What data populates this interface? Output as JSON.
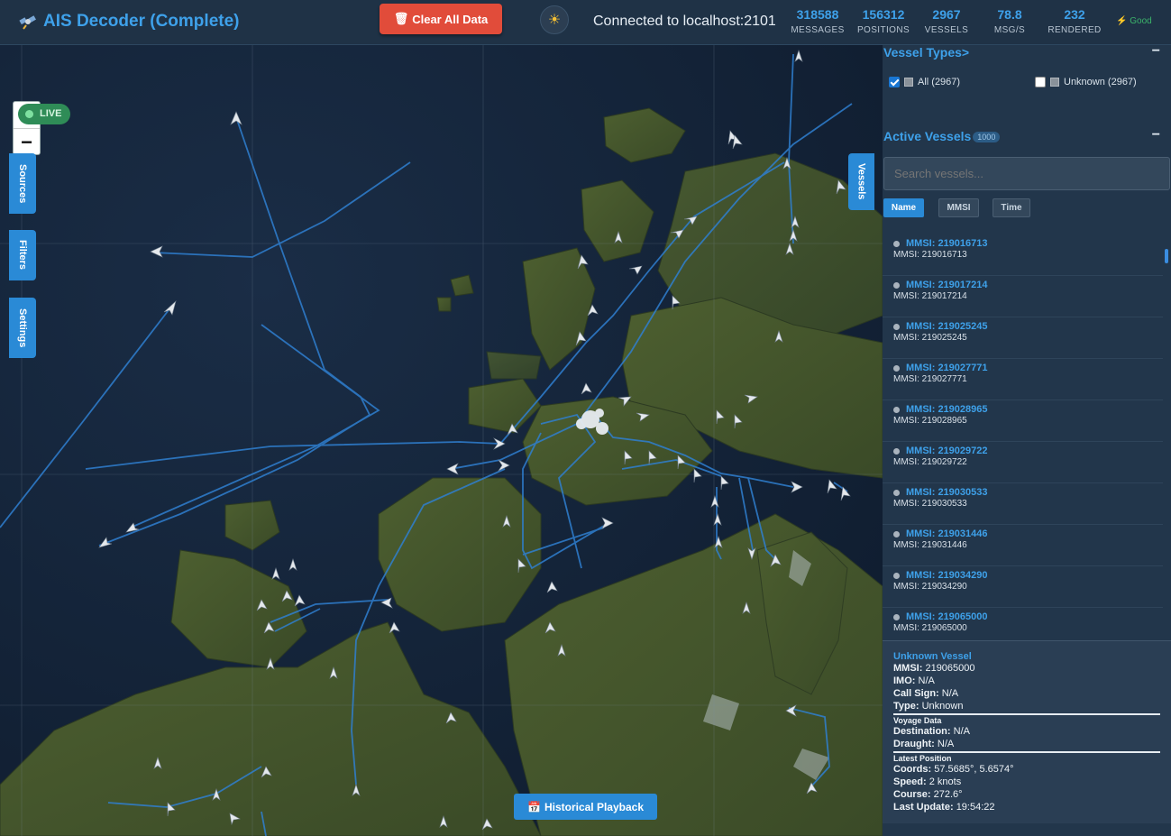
{
  "header": {
    "title": "AIS Decoder (Complete)",
    "clear_label": "Clear All Data",
    "theme_icon": "sun-icon",
    "connection": "Connected to localhost:2101",
    "stats": [
      {
        "value": "318588",
        "label": "MESSAGES"
      },
      {
        "value": "156312",
        "label": "POSITIONS"
      },
      {
        "value": "2967",
        "label": "VESSELS"
      },
      {
        "value": "78.8",
        "label": "MSG/S"
      },
      {
        "value": "232",
        "label": "RENDERED"
      }
    ],
    "performance": "Good"
  },
  "map": {
    "live_label": "LIVE",
    "zoom_in": "+",
    "zoom_out": "−",
    "side_tabs": {
      "sources": "Sources",
      "filters": "Filters",
      "settings": "Settings"
    },
    "vessels_tab": "Vessels",
    "playback_label": "Historical Playback"
  },
  "panel": {
    "types_title": "Vessel Types>",
    "types": [
      {
        "label": "All (2967)",
        "checked": true
      },
      {
        "label": "Unknown (2967)",
        "checked": false
      }
    ],
    "active_title": "Active Vessels",
    "active_count": "1000",
    "collapse_icon": "−",
    "search_placeholder": "Search vessels...",
    "sort_buttons": [
      "Name",
      "MMSI",
      "Time"
    ],
    "vessels": [
      {
        "name": "MMSI: 219016713",
        "mmsi": "MMSI: 219016713"
      },
      {
        "name": "MMSI: 219017214",
        "mmsi": "MMSI: 219017214"
      },
      {
        "name": "MMSI: 219025245",
        "mmsi": "MMSI: 219025245"
      },
      {
        "name": "MMSI: 219027771",
        "mmsi": "MMSI: 219027771"
      },
      {
        "name": "MMSI: 219028965",
        "mmsi": "MMSI: 219028965"
      },
      {
        "name": "MMSI: 219029722",
        "mmsi": "MMSI: 219029722"
      },
      {
        "name": "MMSI: 219030533",
        "mmsi": "MMSI: 219030533"
      },
      {
        "name": "MMSI: 219031446",
        "mmsi": "MMSI: 219031446"
      },
      {
        "name": "MMSI: 219034290",
        "mmsi": "MMSI: 219034290"
      },
      {
        "name": "MMSI: 219065000",
        "mmsi": "MMSI: 219065000"
      }
    ],
    "details": {
      "title": "Unknown Vessel",
      "mmsi_label": "MMSI:",
      "mmsi": "219065000",
      "imo_label": "IMO:",
      "imo": "N/A",
      "callsign_label": "Call Sign:",
      "callsign": "N/A",
      "type_label": "Type:",
      "type": "Unknown",
      "voyage_title": "Voyage Data",
      "dest_label": "Destination:",
      "dest": "N/A",
      "draught_label": "Draught:",
      "draught": "N/A",
      "position_title": "Latest Position",
      "coords_label": "Coords:",
      "coords": "57.5685°, 5.6574°",
      "speed_label": "Speed:",
      "speed": "2 knots",
      "course_label": "Course:",
      "course": "272.6°",
      "update_label": "Last Update:",
      "update": "19:54:22"
    }
  },
  "colors": {
    "accent": "#3ea1ea",
    "danger": "#e14c3a",
    "live": "#2f8c57",
    "track": "#2f7fd0"
  }
}
